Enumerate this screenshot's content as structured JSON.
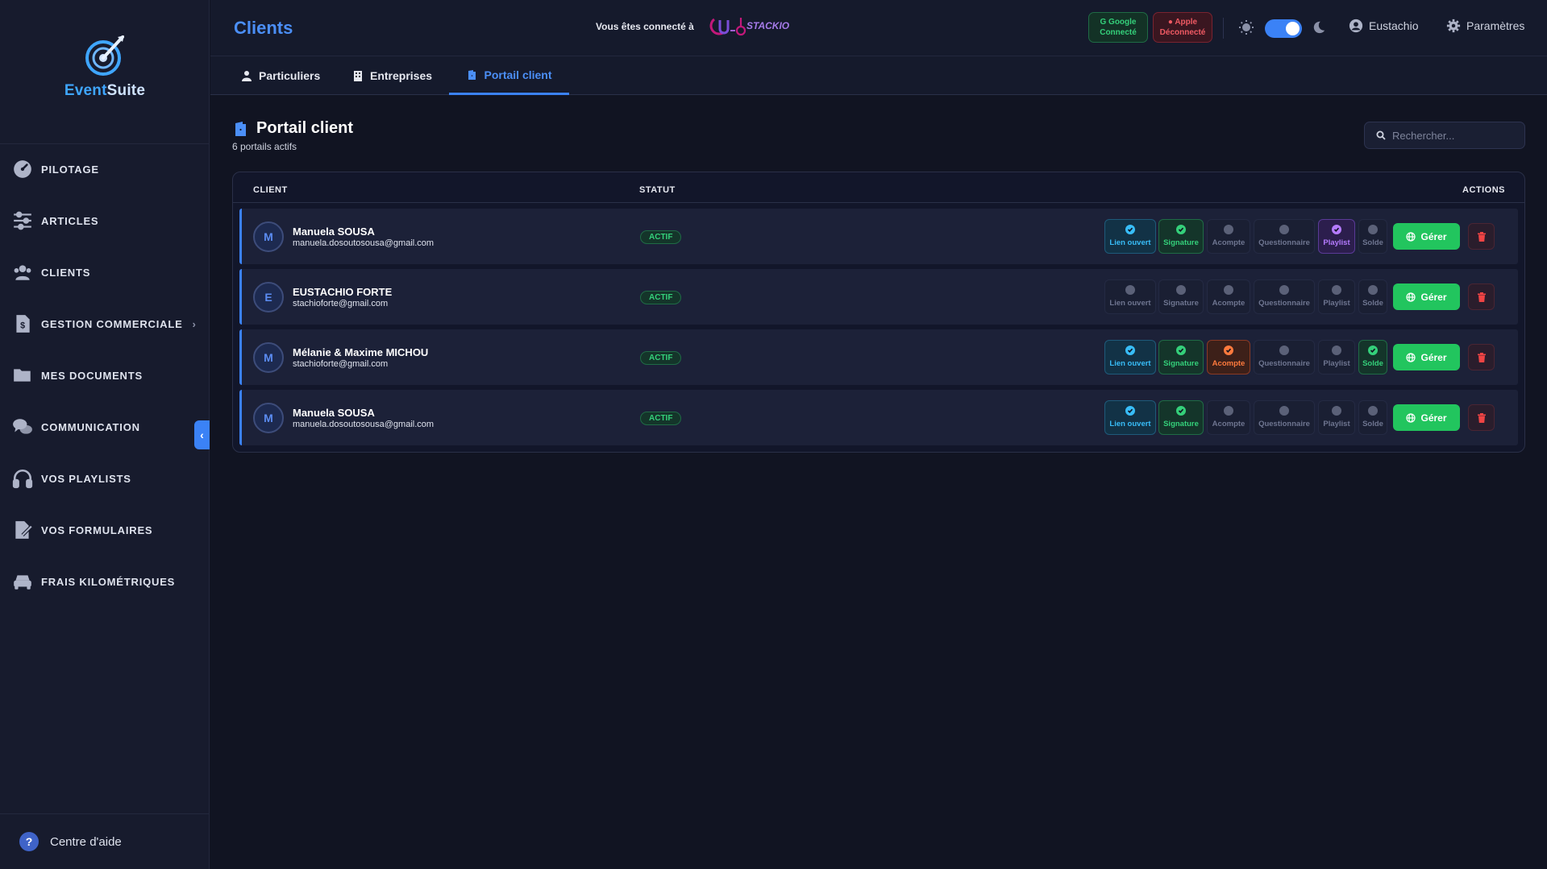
{
  "app": {
    "logo_part1": "Event",
    "logo_part2": "Suite"
  },
  "sidebar": {
    "items": [
      {
        "label": "PILOTAGE",
        "icon": "gauge-icon"
      },
      {
        "label": "ARTICLES",
        "icon": "sliders-icon"
      },
      {
        "label": "CLIENTS",
        "icon": "users-icon"
      },
      {
        "label": "GESTION COMMERCIALE",
        "icon": "invoice-icon",
        "has_submenu": true
      },
      {
        "label": "MES DOCUMENTS",
        "icon": "folder-icon"
      },
      {
        "label": "COMMUNICATION",
        "icon": "chat-icon"
      },
      {
        "label": "VOS PLAYLISTS",
        "icon": "headphones-icon"
      },
      {
        "label": "VOS FORMULAIRES",
        "icon": "form-icon"
      },
      {
        "label": "FRAIS KILOMÉTRIQUES",
        "icon": "car-icon"
      }
    ],
    "help_label": "Centre d'aide"
  },
  "header": {
    "title": "Clients",
    "connected_text": "Vous êtes connecté à",
    "google": {
      "name": "Google",
      "status": "Connecté"
    },
    "apple": {
      "name": "Apple",
      "status": "Déconnecté"
    },
    "theme_dark": true,
    "user_name": "Eustachio",
    "settings_label": "Paramètres"
  },
  "tabs": [
    {
      "label": "Particuliers",
      "active": false
    },
    {
      "label": "Entreprises",
      "active": false
    },
    {
      "label": "Portail client",
      "active": true
    }
  ],
  "section": {
    "title": "Portail client",
    "subtitle": "6 portails actifs",
    "search_placeholder": "Rechercher..."
  },
  "table": {
    "headers": {
      "client": "CLIENT",
      "status": "STATUT",
      "actions": "ACTIONS"
    },
    "chip_labels": [
      "Lien ouvert",
      "Signature",
      "Acompte",
      "Questionnaire",
      "Playlist",
      "Solde"
    ],
    "manage_label": "Gérer",
    "rows": [
      {
        "initial": "M",
        "name": "Manuela SOUSA",
        "email": "manuela.dosoutosousa@gmail.com",
        "status": "ACTIF",
        "chips": [
          "blue",
          "green",
          "off",
          "off",
          "purple",
          "off"
        ]
      },
      {
        "initial": "E",
        "name": "EUSTACHIO FORTE",
        "email": "stachioforte@gmail.com",
        "status": "ACTIF",
        "chips": [
          "off",
          "off",
          "off",
          "off",
          "off",
          "off"
        ]
      },
      {
        "initial": "M",
        "name": "Mélanie & Maxime MICHOU",
        "email": "stachioforte@gmail.com",
        "status": "ACTIF",
        "chips": [
          "blue",
          "green",
          "orange",
          "off",
          "off",
          "green"
        ]
      },
      {
        "initial": "M",
        "name": "Manuela SOUSA",
        "email": "manuela.dosoutosousa@gmail.com",
        "status": "ACTIF",
        "chips": [
          "blue",
          "green",
          "off",
          "off",
          "off",
          "off"
        ]
      }
    ]
  },
  "colors": {
    "accent": "#3b82f6",
    "success": "#22c55e",
    "danger": "#ef4444"
  }
}
